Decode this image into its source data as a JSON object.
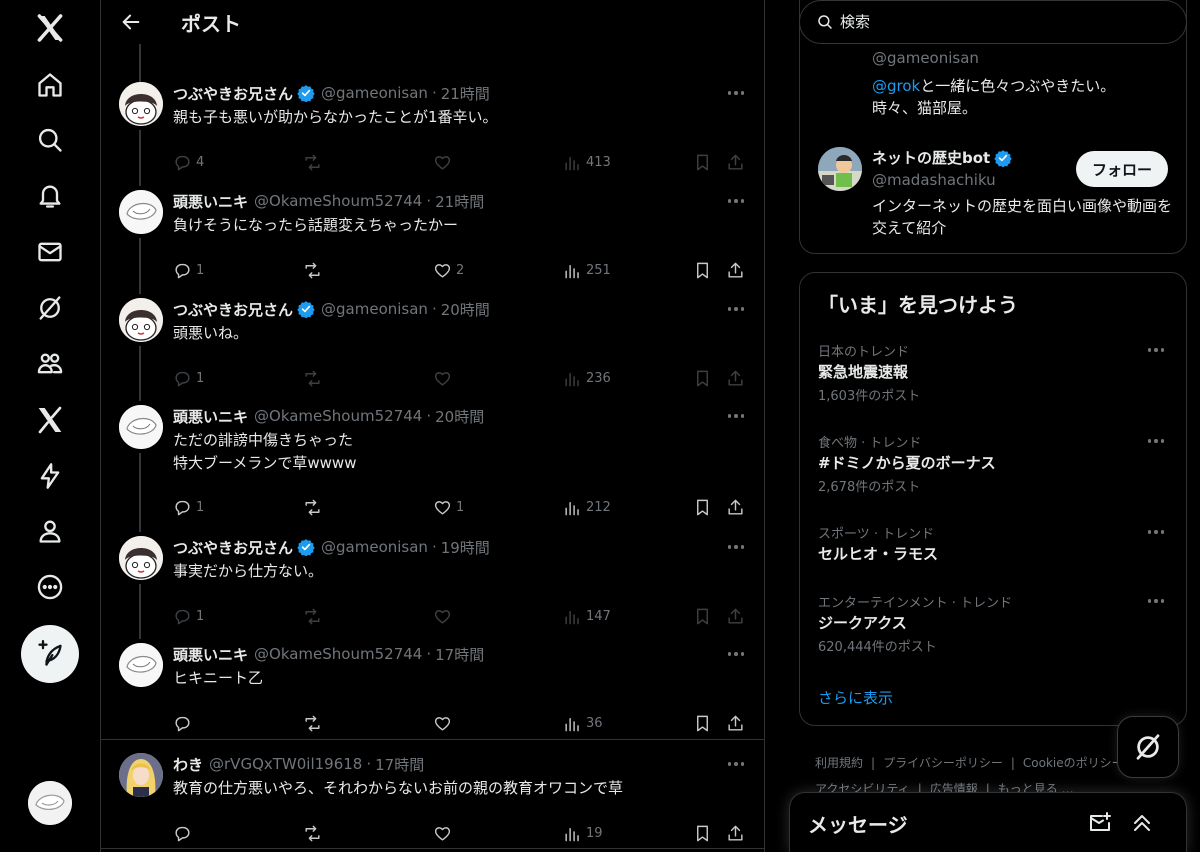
{
  "header": {
    "title": "ポスト"
  },
  "nav": {
    "items": [
      "home",
      "explore",
      "notifications",
      "messages",
      "grok",
      "communities",
      "premium",
      "verified-orgs",
      "profile",
      "more"
    ]
  },
  "posts": [
    {
      "name": "つぶやきお兄さん",
      "verified": true,
      "handle": "@gameonisan",
      "time": "21時間",
      "text": "親も子も悪いが助からなかったことが1番辛い。",
      "replies": "4",
      "likes": "",
      "views": "413"
    },
    {
      "name": "頭悪いニキ",
      "verified": false,
      "handle": "@OkameShoum52744",
      "time": "21時間",
      "text": "負けそうになったら話題変えちゃったかー",
      "replies": "1",
      "likes": "2",
      "views": "251"
    },
    {
      "name": "つぶやきお兄さん",
      "verified": true,
      "handle": "@gameonisan",
      "time": "20時間",
      "text": "頭悪いね。",
      "replies": "1",
      "likes": "",
      "views": "236"
    },
    {
      "name": "頭悪いニキ",
      "verified": false,
      "handle": "@OkameShoum52744",
      "time": "20時間",
      "text": "ただの誹謗中傷きちゃった\n特大ブーメランで草wwww",
      "replies": "1",
      "likes": "1",
      "views": "212"
    },
    {
      "name": "つぶやきお兄さん",
      "verified": true,
      "handle": "@gameonisan",
      "time": "19時間",
      "text": "事実だから仕方ない。",
      "replies": "1",
      "likes": "",
      "views": "147"
    },
    {
      "name": "頭悪いニキ",
      "verified": false,
      "handle": "@OkameShoum52744",
      "time": "17時間",
      "text": "ヒキニート乙",
      "replies": "",
      "likes": "",
      "views": "36"
    },
    {
      "name": "わき",
      "verified": false,
      "handle": "@rVGQxTW0il19618",
      "time": "17時間",
      "text": "教育の仕方悪いやろ、それわからないお前の親の教育オワコンで草",
      "replies": "",
      "likes": "",
      "views": "19"
    }
  ],
  "search": {
    "placeholder": "検索"
  },
  "who_to_follow": [
    {
      "handle": "@gameonisan",
      "bio_mention": "@grok",
      "bio_rest": "と一緒に色々つぶやきたい。",
      "bio_line2": "時々、猫部屋。"
    },
    {
      "name": "ネットの歴史bot",
      "verified": true,
      "handle": "@madashachiku",
      "bio": "インターネットの歴史を面白い画像や動画を交えて紹介",
      "follow_label": "フォロー"
    }
  ],
  "trends": {
    "title": "「いま」を見つけよう",
    "items": [
      {
        "meta": "日本のトレンド",
        "topic": "緊急地震速報",
        "count": "1,603件のポスト"
      },
      {
        "meta": "食べ物 · トレンド",
        "topic": "#ドミノから夏のボーナス",
        "count": "2,678件のポスト"
      },
      {
        "meta": "スポーツ · トレンド",
        "topic": "セルヒオ・ラモス",
        "count": ""
      },
      {
        "meta": "エンターテインメント · トレンド",
        "topic": "ジークアクス",
        "count": "620,444件のポスト"
      }
    ],
    "show_more": "さらに表示"
  },
  "footer": {
    "links_row1": [
      "利用規約",
      "プライバシーポリシー",
      "Cookieのポリシー"
    ],
    "links_row2": [
      "アクセシビリティ",
      "広告情報",
      "もっと見る …"
    ]
  },
  "messages": {
    "title": "メッセージ"
  },
  "colors": {
    "accent": "#1d9bf0",
    "text": "#e7e9ea",
    "muted": "#71767b",
    "border": "#2f3336"
  }
}
